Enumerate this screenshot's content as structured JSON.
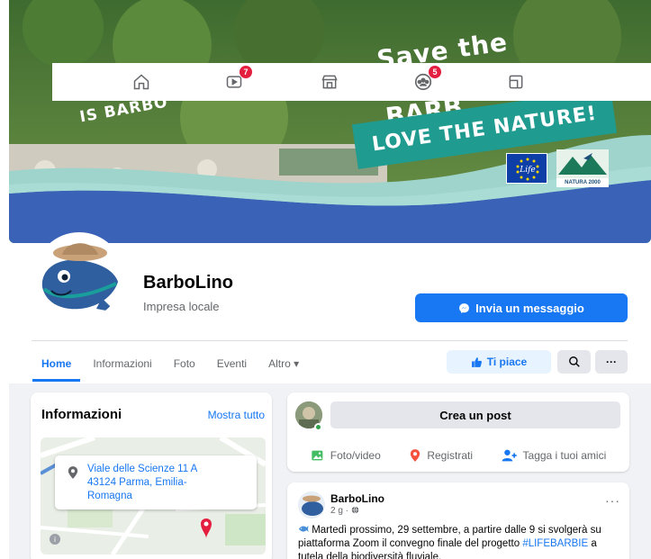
{
  "nav": {
    "badges": {
      "watch": "7",
      "groups": "5"
    }
  },
  "cover": {
    "headline_top": "Save the",
    "headline_bottom": "BARB",
    "tagline": "LOVE THE NATURE!",
    "left_text": "IS BARBO",
    "logo_life": "Life",
    "logo_natura": "NATURA 2000"
  },
  "page": {
    "name": "BarboLino",
    "category": "Impresa locale",
    "message_button": "Invia un messaggio"
  },
  "tabs": [
    {
      "label": "Home"
    },
    {
      "label": "Informazioni"
    },
    {
      "label": "Foto"
    },
    {
      "label": "Eventi"
    },
    {
      "label": "Altro ▾"
    }
  ],
  "actions": {
    "like": "Ti piace",
    "more": "···"
  },
  "info": {
    "title": "Informazioni",
    "show_all": "Mostra tutto",
    "address_line1": "Viale delle Scienze 11 A",
    "address_line2": "43124 Parma, Emilia-",
    "address_line3": "Romagna"
  },
  "create_post": {
    "label": "Crea un post",
    "photo_video": "Foto/video",
    "checkin": "Registrati",
    "tag_friends": "Tagga i tuoi amici"
  },
  "post": {
    "author": "BarboLino",
    "meta": "2 g · ",
    "more": "···",
    "text_part1": "Martedì prossimo, 29 settembre, a partire dalle 9 si svolgerà su piattaforma Zoom il convegno finale del progetto ",
    "hashtag": "#LIFEBARBIE",
    "text_part2": " a tutela della biodiversità fluviale."
  },
  "colors": {
    "accent": "#1877f2",
    "badge": "#e41e3f",
    "teal": "#1f9b8f",
    "online": "#31a24c"
  }
}
